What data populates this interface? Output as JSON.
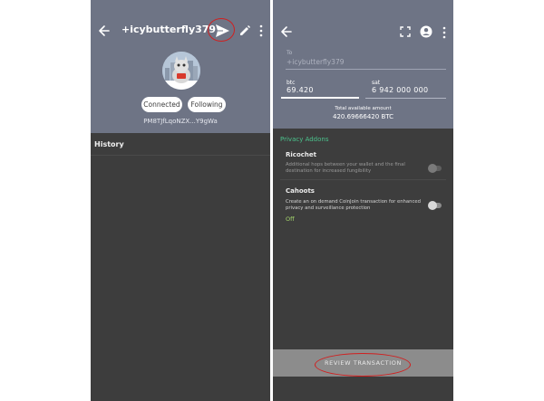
{
  "left_screen": {
    "title": "+icybutterfly379",
    "connected_label": "Connected",
    "following_label": "Following",
    "payment_code": "PM8TJfLqoNZX...Y9gWa",
    "history_label": "History",
    "header_color": "#6e7485",
    "body_color": "#3d3d3d",
    "icons": [
      "back-arrow-icon",
      "send-icon",
      "edit-icon",
      "more-vert-icon"
    ]
  },
  "right_screen": {
    "to": {
      "label": "To",
      "value": "+icybutterfly379"
    },
    "btc": {
      "label": "btc",
      "value": "69.420"
    },
    "sat": {
      "label": "sat",
      "value": "6 942 000 000"
    },
    "total_label": "Total available amount",
    "total_value": "420.69666420 BTC",
    "privacy_title": "Privacy Addons",
    "ricochet": {
      "title": "Ricochet",
      "description": "Additional hops between your wallet and the final destination for increased fungibility",
      "enabled": false
    },
    "cahoots": {
      "title": "Cahoots",
      "description": "Create an on demand CoinJoin transaction for enhanced privacy and surveillance protection",
      "status": "Off",
      "enabled": false
    },
    "review_button": "REVIEW TRANSACTION",
    "accent_green": "#4bc28c",
    "status_green": "#a7d96e",
    "highlight_red": "#d11f1f",
    "icons": [
      "back-arrow-icon",
      "fullscreen-icon",
      "account-circle-icon",
      "more-vert-icon"
    ]
  }
}
